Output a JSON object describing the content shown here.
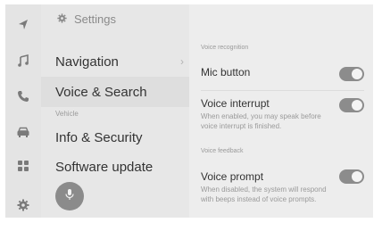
{
  "header": {
    "title": "Settings"
  },
  "rail": {
    "icons": [
      "navigation-arrow-icon",
      "music-note-icon",
      "phone-icon",
      "car-icon",
      "apps-grid-icon",
      "gear-icon"
    ]
  },
  "menu": {
    "items": [
      {
        "label": "Navigation",
        "active": false
      },
      {
        "label": "Voice & Search",
        "active": true
      },
      {
        "label": "Info & Security",
        "active": false
      },
      {
        "label": "Software update",
        "active": false
      }
    ],
    "section_vehicle": "Vehicle"
  },
  "content": {
    "voice_recognition": {
      "section_label": "Voice recognition",
      "mic_button": {
        "title": "Mic button",
        "enabled": true
      },
      "voice_interrupt": {
        "title": "Voice interrupt",
        "description": "When enabled, you may speak before voice interrupt is finished.",
        "enabled": true
      }
    },
    "voice_feedback": {
      "section_label": "Voice feedback",
      "voice_prompt": {
        "title": "Voice prompt",
        "description": "When disabled, the system will respond with beeps instead of voice prompts.",
        "enabled": true
      }
    }
  },
  "colors": {
    "accent": "#8c8c8c",
    "background": "#ececec"
  }
}
